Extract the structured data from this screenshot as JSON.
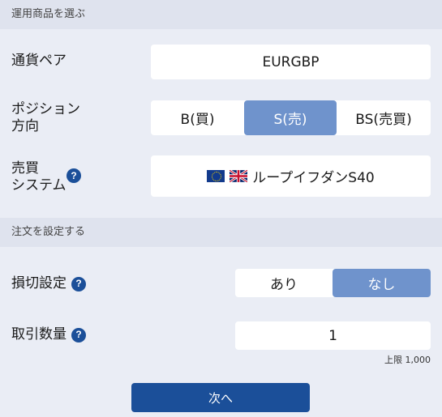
{
  "sections": {
    "select_product": "運用商品を選ぶ",
    "set_order": "注文を設定する"
  },
  "currency_pair": {
    "label": "通貨ペア",
    "value": "EURGBP"
  },
  "position_direction": {
    "label_line1": "ポジション",
    "label_line2": "方向",
    "options": [
      "B(買)",
      "S(売)",
      "BS(売買)"
    ],
    "selected": "S(売)"
  },
  "trading_system": {
    "label_line1": "売買",
    "label_line2": "システム",
    "help": "?",
    "icons": [
      "eu-flag-icon",
      "uk-flag-icon"
    ],
    "value": "ループイフダンS40"
  },
  "stop_loss": {
    "label": "損切設定",
    "help": "?",
    "options": [
      "あり",
      "なし"
    ],
    "selected": "なし"
  },
  "quantity": {
    "label": "取引数量",
    "help": "?",
    "value": "1",
    "limit_note": "上限 1,000"
  },
  "next_button": "次へ",
  "colors": {
    "background": "#eaedf5",
    "section_header": "#dfe3ee",
    "accent": "#1b4f99",
    "selected": "#6f93cc"
  }
}
